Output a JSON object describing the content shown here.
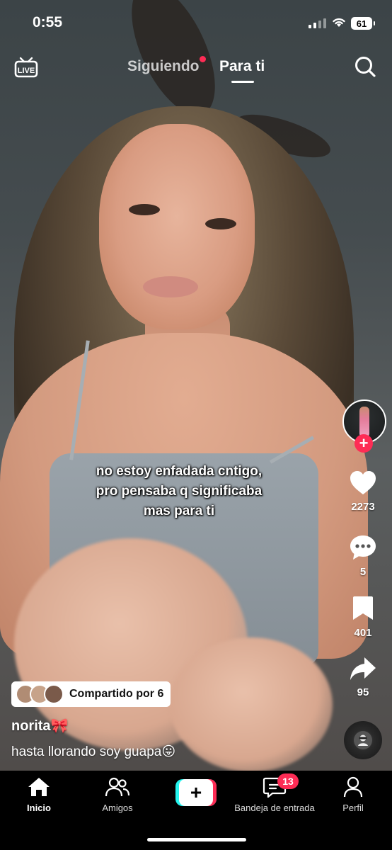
{
  "status_bar": {
    "time": "0:55",
    "battery": "61"
  },
  "top_nav": {
    "live_label": "LIVE",
    "tab_following": "Siguiendo",
    "tab_for_you": "Para ti"
  },
  "video": {
    "overlay_text": [
      "no estoy enfadada cntigo,",
      "pro pensaba q significaba",
      "mas para ti"
    ]
  },
  "actions": {
    "likes": "2273",
    "comments": "5",
    "saves": "401",
    "shares": "95"
  },
  "post": {
    "shared_label": "Compartido por 6",
    "username": "norita🎀",
    "description": "hasta llorando soy guapa😛"
  },
  "tab_bar": {
    "home": "Inicio",
    "friends": "Amigos",
    "create": "+",
    "inbox": "Bandeja de entrada",
    "inbox_badge": "13",
    "profile": "Perfil"
  },
  "colors": {
    "accent": "#fe2c55",
    "cyan": "#25f4ee"
  }
}
